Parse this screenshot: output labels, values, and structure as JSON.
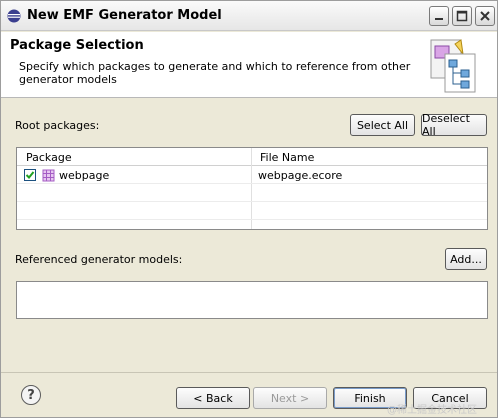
{
  "window": {
    "title": "New EMF Generator Model"
  },
  "header": {
    "title": "Package Selection",
    "description": "Specify which packages to generate and which to reference from other generator models"
  },
  "root_packages": {
    "label": "Root packages:",
    "select_all_label": "Select All",
    "deselect_all_label": "Deselect All",
    "columns": [
      "Package",
      "File Name"
    ],
    "rows": [
      {
        "package": "webpage",
        "file_name": "webpage.ecore",
        "checked": true
      }
    ]
  },
  "referenced": {
    "label": "Referenced generator models:",
    "add_label": "Add..."
  },
  "footer": {
    "help_glyph": "?",
    "back_label": "< Back",
    "next_label": "Next >",
    "finish_label": "Finish",
    "cancel_label": "Cancel",
    "watermark": "@稀土掘金技术社区"
  },
  "colors": {
    "dialog_bg": "#ece9d8",
    "checkbox_check": "#21a121",
    "package_icon": "#a45cc4"
  }
}
